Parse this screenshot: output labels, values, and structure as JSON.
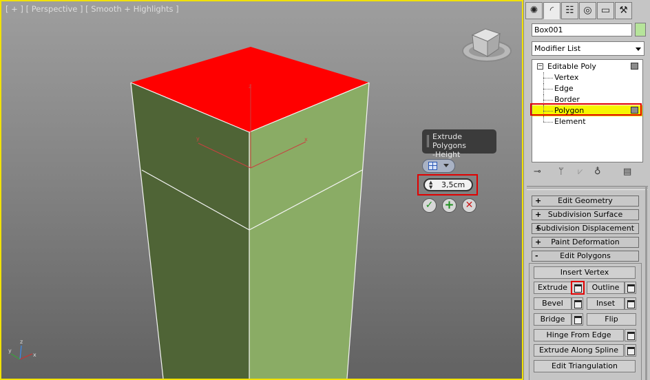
{
  "viewport": {
    "label": "[ + ] [ Perspective ] [ Smooth + Highlights ]",
    "caddy": {
      "title_line1": "Extrude Polygons",
      "title_line2": "-Height",
      "height_value": "3,5cm"
    }
  },
  "panel": {
    "tabs": [
      "create-icon",
      "modify-icon",
      "hierarchy-icon",
      "motion-icon",
      "display-icon",
      "utilities-icon"
    ],
    "object_name": "Box001",
    "object_color": "#b6e49a",
    "modifier_list_label": "Modifier List",
    "stack": {
      "base": "Editable Poly",
      "subobjects": [
        "Vertex",
        "Edge",
        "Border",
        "Polygon",
        "Element"
      ],
      "selected": "Polygon"
    },
    "rollouts": [
      {
        "sign": "+",
        "label": "Edit Geometry"
      },
      {
        "sign": "+",
        "label": "Subdivision Surface"
      },
      {
        "sign": "+",
        "label": "Subdivision Displacement"
      },
      {
        "sign": "+",
        "label": "Paint Deformation"
      },
      {
        "sign": "-",
        "label": "Edit Polygons"
      }
    ],
    "edit_polygons": {
      "insert_vertex": "Insert Vertex",
      "extrude": "Extrude",
      "outline": "Outline",
      "bevel": "Bevel",
      "inset": "Inset",
      "bridge": "Bridge",
      "flip": "Flip",
      "hinge": "Hinge From Edge",
      "extrude_spline": "Extrude Along Spline",
      "edit_triangulation": "Edit Triangulation"
    }
  },
  "colors": {
    "selection": "#ff0000",
    "face_left": "#4f6436",
    "face_right": "#8aac65",
    "active_border": "#f2e200"
  }
}
